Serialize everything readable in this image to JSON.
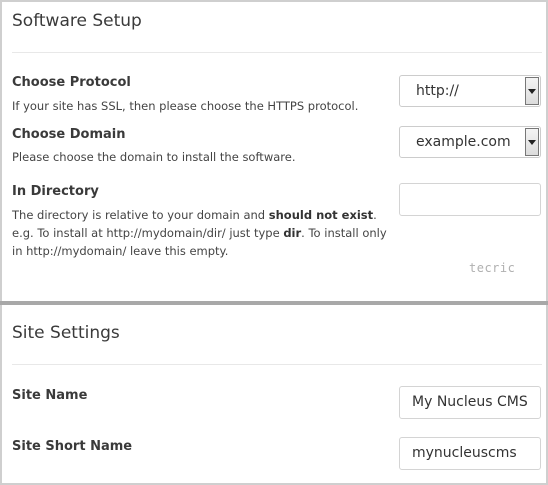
{
  "software_setup": {
    "title": "Software Setup",
    "protocol": {
      "label": "Choose Protocol",
      "help": "If your site has SSL, then please choose the HTTPS protocol.",
      "value": "http://"
    },
    "domain": {
      "label": "Choose Domain",
      "help": "Please choose the domain to install the software.",
      "value": "example.com"
    },
    "directory": {
      "label": "In Directory",
      "help_part1": "The directory is relative to your domain and ",
      "help_bold1": "should not exist",
      "help_part2": ". e.g. To install at http://mydomain/dir/ just type ",
      "help_bold2": "dir",
      "help_part3": ". To install only in http://mydomain/ leave this empty.",
      "value": ""
    },
    "watermark": "tecric"
  },
  "site_settings": {
    "title": "Site Settings",
    "site_name": {
      "label": "Site Name",
      "value": "My Nucleus CMS"
    },
    "site_short_name": {
      "label": "Site Short Name",
      "value": "mynucleuscms"
    }
  }
}
